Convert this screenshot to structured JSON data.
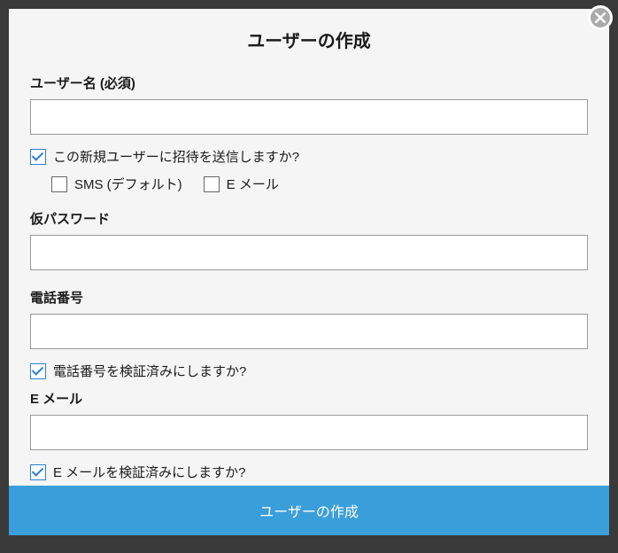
{
  "title": "ユーザーの作成",
  "fields": {
    "username": {
      "label": "ユーザー名 (必須)",
      "value": ""
    },
    "invite": {
      "label": "この新規ユーザーに招待を送信しますか?",
      "checked": true
    },
    "invite_sms": {
      "label": "SMS (デフォルト)",
      "checked": false
    },
    "invite_email": {
      "label": "E メール",
      "checked": false
    },
    "temp_password": {
      "label": "仮パスワード",
      "value": ""
    },
    "phone": {
      "label": "電話番号",
      "value": ""
    },
    "phone_verified": {
      "label": "電話番号を検証済みにしますか?",
      "checked": true
    },
    "email": {
      "label": "E メール",
      "value": ""
    },
    "email_verified": {
      "label": "E メールを検証済みにしますか?",
      "checked": true
    }
  },
  "submit_label": "ユーザーの作成"
}
